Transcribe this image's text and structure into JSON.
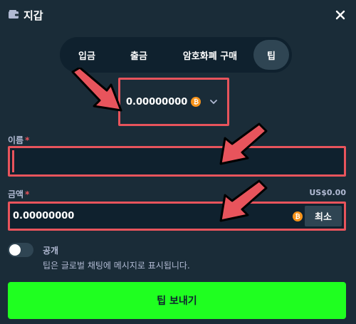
{
  "header": {
    "title": "지갑",
    "wallet_icon": "wallet-icon",
    "close_icon": "close-icon"
  },
  "tabs": [
    {
      "label": "입금",
      "active": false
    },
    {
      "label": "출금",
      "active": false
    },
    {
      "label": "암호화폐 구매",
      "active": false
    },
    {
      "label": "팁",
      "active": true
    }
  ],
  "currency": {
    "amount": "0.00000000",
    "coin_icon": "bitcoin-icon",
    "dropdown_icon": "chevron-down-icon"
  },
  "name_field": {
    "label": "이름",
    "required_mark": "*",
    "value": ""
  },
  "amount_field": {
    "label": "금액",
    "required_mark": "*",
    "usd_value": "US$0.00",
    "value": "0.00000000",
    "min_label": "최소"
  },
  "public_toggle": {
    "label": "공개",
    "on": false,
    "hint": "팁은 글로벌 채팅에 메시지로 표시됩니다."
  },
  "send_button": {
    "label": "팁 보내기"
  },
  "colors": {
    "background": "#1a2c38",
    "input_bg": "#0f212e",
    "accent_green": "#1fff20",
    "highlight_red": "#e8545c",
    "muted_text": "#b1bad3"
  }
}
